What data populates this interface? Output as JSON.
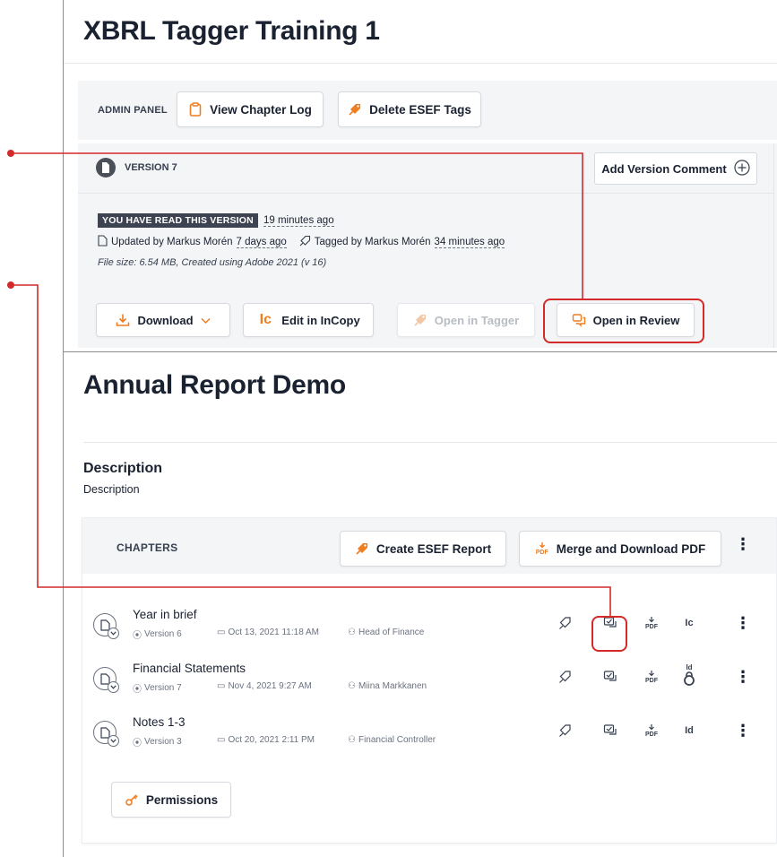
{
  "panel1": {
    "title": "XBRL Tagger Training 1",
    "admin": {
      "label": "ADMIN PANEL",
      "view_log": "View Chapter Log",
      "delete_tags": "Delete ESEF Tags"
    },
    "version": {
      "label": "VERSION 7",
      "add_comment": "Add Version Comment",
      "read_badge": "YOU HAVE READ THIS VERSION",
      "read_time": "19 minutes ago",
      "updated_prefix": "Updated by Markus Morén",
      "updated_time": "7 days ago",
      "tagged_prefix": "Tagged by Markus Morén",
      "tagged_time": "34 minutes ago",
      "file_info": "File size: 6.54 MB, Created using Adobe 2021 (v 16)",
      "download": "Download",
      "edit_incopy": "Edit in InCopy",
      "open_tagger": "Open in Tagger",
      "open_review": "Open in Review",
      "incopy_glyph": "Ic"
    }
  },
  "panel2": {
    "title": "Annual Report Demo",
    "description_heading": "Description",
    "description_text": "Description",
    "chapters_label": "CHAPTERS",
    "create_esef": "Create ESEF Report",
    "merge_pdf": "Merge and Download PDF",
    "permissions": "Permissions",
    "pdf_glyph": "PDF",
    "chapters": [
      {
        "title": "Year in brief",
        "version": "Version 6",
        "date": "Oct 13, 2021 11:18 AM",
        "user": "Head of Finance",
        "app_glyph": "Ic"
      },
      {
        "title": "Financial Statements",
        "version": "Version 7",
        "date": "Nov 4, 2021 9:27 AM",
        "user": "Miina Markkanen",
        "app_glyph": "Id"
      },
      {
        "title": "Notes 1-3",
        "version": "Version 3",
        "date": "Oct 20, 2021 2:11 PM",
        "user": "Financial Controller",
        "app_glyph": "Id"
      }
    ]
  },
  "colors": {
    "accent": "#ef7d22",
    "annotation": "#d42a2a",
    "dark_badge": "#3d4350",
    "panel_bg": "#f4f5f7"
  }
}
